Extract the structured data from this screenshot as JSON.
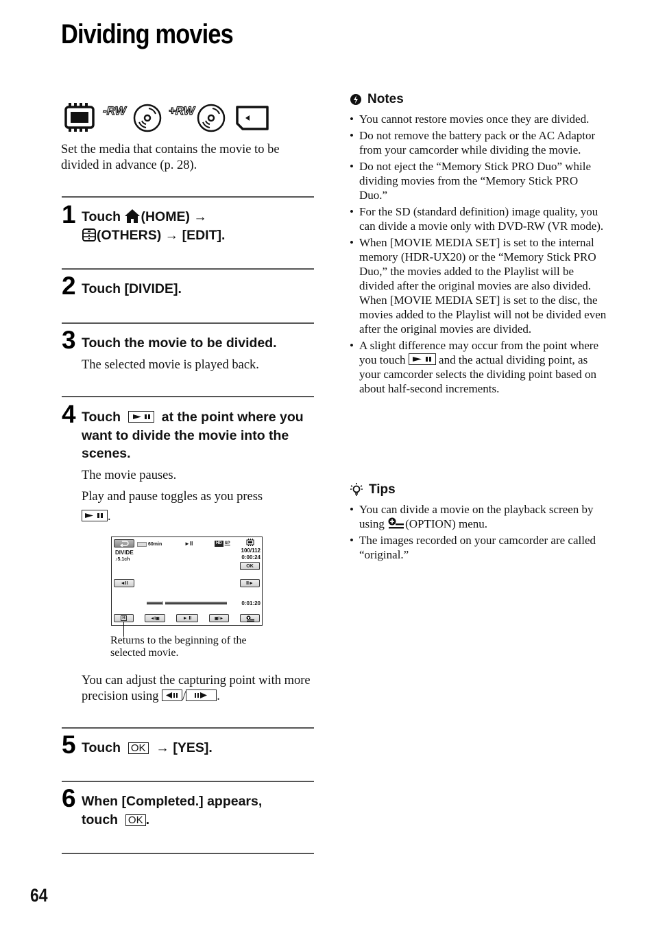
{
  "page": {
    "title": "Dividing movies",
    "page_number": "64"
  },
  "media_icons": [
    "internal-memory-icon",
    "dvd-rw-minus-icon",
    "dvd-rw-plus-icon",
    "memory-stick-icon"
  ],
  "media_icon_labels": {
    "minus_rw": "-RW",
    "plus_rw": "+RW"
  },
  "intro": "Set the media that contains the movie to be divided in advance (p. 28).",
  "steps": [
    {
      "number": "1",
      "parts": {
        "touch": "Touch",
        "home": "(HOME) →",
        "others": "(OTHERS) → [EDIT]."
      }
    },
    {
      "number": "2",
      "text": "Touch [DIVIDE]."
    },
    {
      "number": "3",
      "text": "Touch the movie to be divided.",
      "sub": "The selected movie is played back."
    },
    {
      "number": "4",
      "parts": {
        "touch": "Touch",
        "rest": "at the point where you want to divide the movie into the scenes."
      },
      "sub1": "The movie pauses.",
      "sub2": "Play and pause toggles as you press",
      "sub2_end": ".",
      "adjust_a": "You can adjust the capturing point with more precision using",
      "adjust_sep": "/",
      "adjust_end": "."
    },
    {
      "number": "5",
      "parts": {
        "touch": "Touch",
        "ok": "OK",
        "rest": "→ [YES]."
      }
    },
    {
      "number": "6",
      "parts": {
        "line1": "When [Completed.] appears,",
        "touch": "touch",
        "ok": "OK",
        "end": "."
      }
    }
  ],
  "screen": {
    "battery": "60min",
    "play_pause": "►II",
    "quality_hd": "HD",
    "quality_mode": "SP",
    "mode_label": "DIVIDE",
    "audio": "♪5.1ch",
    "counter": "100/112",
    "time_top": "0:00:24",
    "ok": "OK",
    "prev_frame": "◄II",
    "next_frame": "II►",
    "time_bottom": "0:01:20",
    "progress_fraction": 0.2,
    "bottom_buttons": [
      "return-start",
      "prev-scene",
      "play-pause",
      "next-scene",
      "option"
    ],
    "callout": "Returns to the beginning of the selected movie."
  },
  "notes": {
    "heading": "Notes",
    "items": [
      "You cannot restore movies once they are divided.",
      "Do not remove the battery pack or the AC Adaptor from your camcorder while dividing the movie.",
      "Do not eject the “Memory Stick PRO Duo” while dividing movies from the “Memory Stick PRO Duo.”",
      "For the SD (standard definition) image quality, you can divide a movie only with DVD-RW (VR mode).",
      "When [MOVIE MEDIA SET] is set to the internal memory (HDR-UX20) or the “Memory Stick PRO Duo,” the movies added to the Playlist will be divided after the original movies are also divided.",
      "When [MOVIE MEDIA SET] is set to the disc, the movies added to the Playlist will not be divided even after the original movies are divided.",
      "A slight difference may occur from the point where you touch",
      "and the actual dividing point, as your camcorder selects the dividing point based on about half-second increments."
    ]
  },
  "tips": {
    "heading": "Tips",
    "items": [
      {
        "a": "You can divide a movie on the playback screen by using",
        "b": "(OPTION) menu."
      },
      {
        "a": "The images recorded on your camcorder are called “original.”"
      }
    ]
  }
}
